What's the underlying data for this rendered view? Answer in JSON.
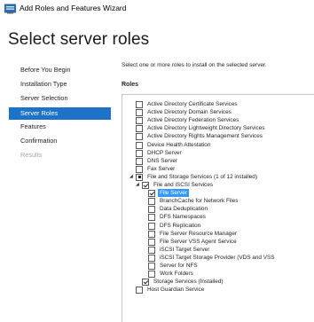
{
  "window": {
    "title": "Add Roles and Features Wizard"
  },
  "page": {
    "title": "Select server roles"
  },
  "nav": {
    "items": [
      {
        "label": "Before You Begin",
        "state": "normal"
      },
      {
        "label": "Installation Type",
        "state": "normal"
      },
      {
        "label": "Server Selection",
        "state": "normal"
      },
      {
        "label": "Server Roles",
        "state": "active"
      },
      {
        "label": "Features",
        "state": "normal"
      },
      {
        "label": "Confirmation",
        "state": "normal"
      },
      {
        "label": "Results",
        "state": "disabled"
      }
    ]
  },
  "main": {
    "instruction": "Select one or more roles to install on the selected server.",
    "roles_label": "Roles",
    "roles": [
      {
        "label": "Active Directory Certificate Services",
        "state": "unchecked",
        "indent": 0
      },
      {
        "label": "Active Directory Domain Services",
        "state": "unchecked",
        "indent": 0
      },
      {
        "label": "Active Directory Federation Services",
        "state": "unchecked",
        "indent": 0
      },
      {
        "label": "Active Directory Lightweight Directory Services",
        "state": "unchecked",
        "indent": 0
      },
      {
        "label": "Active Directory Rights Management Services",
        "state": "unchecked",
        "indent": 0
      },
      {
        "label": "Device Health Attestation",
        "state": "unchecked",
        "indent": 0
      },
      {
        "label": "DHCP Server",
        "state": "unchecked",
        "indent": 0
      },
      {
        "label": "DNS Server",
        "state": "unchecked",
        "indent": 0
      },
      {
        "label": "Fax Server",
        "state": "unchecked",
        "indent": 0
      },
      {
        "label": "File and Storage Services (1 of 12 installed)",
        "state": "partial",
        "indent": 0,
        "expander": "expanded"
      },
      {
        "label": "File and iSCSI Services",
        "state": "checked",
        "indent": 1,
        "expander": "expanded"
      },
      {
        "label": "File Server",
        "state": "checked",
        "indent": 2,
        "selected": true
      },
      {
        "label": "BranchCache for Network Files",
        "state": "unchecked",
        "indent": 2
      },
      {
        "label": "Data Deduplication",
        "state": "unchecked",
        "indent": 2
      },
      {
        "label": "DFS Namespaces",
        "state": "unchecked",
        "indent": 2
      },
      {
        "label": "DFS Replication",
        "state": "unchecked",
        "indent": 2
      },
      {
        "label": "File Server Resource Manager",
        "state": "unchecked",
        "indent": 2
      },
      {
        "label": "File Server VSS Agent Service",
        "state": "unchecked",
        "indent": 2
      },
      {
        "label": "iSCSI Target Server",
        "state": "unchecked",
        "indent": 2
      },
      {
        "label": "iSCSI Target Storage Provider (VDS and VSS",
        "state": "unchecked",
        "indent": 2
      },
      {
        "label": "Server for NFS",
        "state": "unchecked",
        "indent": 2
      },
      {
        "label": "Work Folders",
        "state": "unchecked",
        "indent": 2
      },
      {
        "label": "Storage Services (Installed)",
        "state": "checked",
        "indent": 1
      },
      {
        "label": "Host Guardian Service",
        "state": "unchecked",
        "indent": 0
      }
    ]
  },
  "colors": {
    "accent": "#1e73c9",
    "selection": "#3399ff",
    "disabled_text": "#a5a5a5"
  },
  "icons": {
    "app": "server-manager-icon"
  }
}
